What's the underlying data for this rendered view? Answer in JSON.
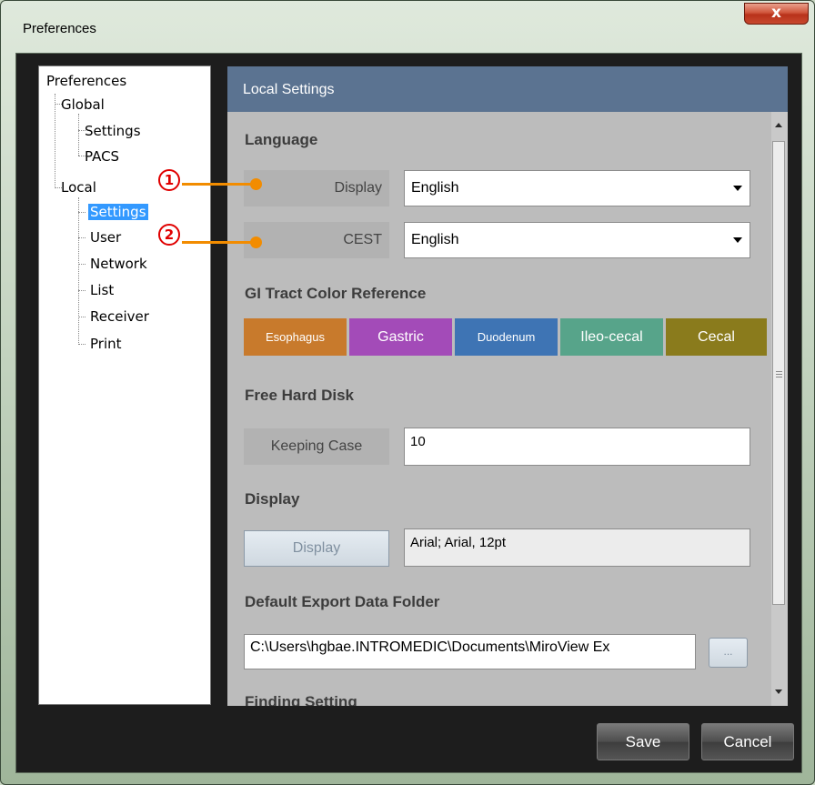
{
  "window": {
    "title": "Preferences",
    "close_glyph": "x"
  },
  "tree": {
    "root": "Preferences",
    "global": {
      "label": "Global",
      "children": [
        "Settings",
        "PACS"
      ]
    },
    "local": {
      "label": "Local",
      "children": [
        "Settings",
        "User",
        "Network",
        "List",
        "Receiver",
        "Print"
      ]
    },
    "selected": "Local > Settings"
  },
  "panel": {
    "header": "Local Settings",
    "language": {
      "title": "Language",
      "display_label": "Display",
      "display_value": "English",
      "cest_label": "CEST",
      "cest_value": "English"
    },
    "gi_tract": {
      "title": "GI Tract Color Reference",
      "segments": [
        {
          "label": "Esophagus",
          "color": "#c87a2c"
        },
        {
          "label": "Gastric",
          "color": "#a34bb8"
        },
        {
          "label": "Duodenum",
          "color": "#3e74b4"
        },
        {
          "label": "Ileo-cecal",
          "color": "#57a48a"
        },
        {
          "label": "Cecal",
          "color": "#8a7b1c"
        }
      ]
    },
    "free_hard_disk": {
      "title": "Free Hard Disk",
      "keeping_case_label": "Keeping Case",
      "keeping_case_value": "10"
    },
    "display": {
      "title": "Display",
      "button_label": "Display",
      "font_value": "Arial; Arial, 12pt"
    },
    "export_folder": {
      "title": "Default Export Data Folder",
      "path": "C:\\Users\\hgbae.INTROMEDIC\\Documents\\MiroView Ex",
      "browse_label": "..."
    },
    "finding_setting": {
      "title": "Finding Setting"
    }
  },
  "buttons": {
    "save": "Save",
    "cancel": "Cancel"
  },
  "annotations": {
    "one": "1",
    "two": "2",
    "color": "#f28c00"
  }
}
